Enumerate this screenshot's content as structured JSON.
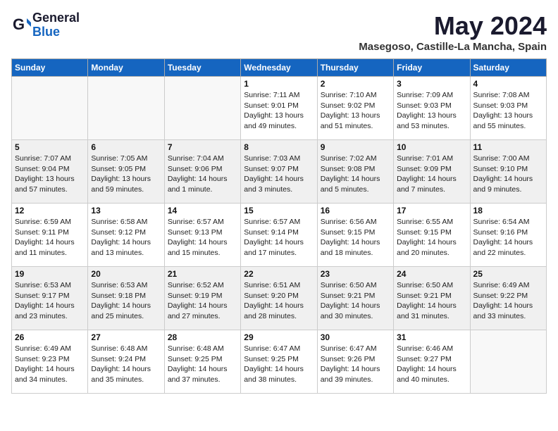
{
  "header": {
    "logo_general": "General",
    "logo_blue": "Blue",
    "title": "May 2024",
    "location": "Masegoso, Castille-La Mancha, Spain"
  },
  "weekdays": [
    "Sunday",
    "Monday",
    "Tuesday",
    "Wednesday",
    "Thursday",
    "Friday",
    "Saturday"
  ],
  "weeks": [
    [
      {
        "day": "",
        "info": []
      },
      {
        "day": "",
        "info": []
      },
      {
        "day": "",
        "info": []
      },
      {
        "day": "1",
        "info": [
          "Sunrise: 7:11 AM",
          "Sunset: 9:01 PM",
          "Daylight: 13 hours",
          "and 49 minutes."
        ]
      },
      {
        "day": "2",
        "info": [
          "Sunrise: 7:10 AM",
          "Sunset: 9:02 PM",
          "Daylight: 13 hours",
          "and 51 minutes."
        ]
      },
      {
        "day": "3",
        "info": [
          "Sunrise: 7:09 AM",
          "Sunset: 9:03 PM",
          "Daylight: 13 hours",
          "and 53 minutes."
        ]
      },
      {
        "day": "4",
        "info": [
          "Sunrise: 7:08 AM",
          "Sunset: 9:03 PM",
          "Daylight: 13 hours",
          "and 55 minutes."
        ]
      }
    ],
    [
      {
        "day": "5",
        "info": [
          "Sunrise: 7:07 AM",
          "Sunset: 9:04 PM",
          "Daylight: 13 hours",
          "and 57 minutes."
        ]
      },
      {
        "day": "6",
        "info": [
          "Sunrise: 7:05 AM",
          "Sunset: 9:05 PM",
          "Daylight: 13 hours",
          "and 59 minutes."
        ]
      },
      {
        "day": "7",
        "info": [
          "Sunrise: 7:04 AM",
          "Sunset: 9:06 PM",
          "Daylight: 14 hours",
          "and 1 minute."
        ]
      },
      {
        "day": "8",
        "info": [
          "Sunrise: 7:03 AM",
          "Sunset: 9:07 PM",
          "Daylight: 14 hours",
          "and 3 minutes."
        ]
      },
      {
        "day": "9",
        "info": [
          "Sunrise: 7:02 AM",
          "Sunset: 9:08 PM",
          "Daylight: 14 hours",
          "and 5 minutes."
        ]
      },
      {
        "day": "10",
        "info": [
          "Sunrise: 7:01 AM",
          "Sunset: 9:09 PM",
          "Daylight: 14 hours",
          "and 7 minutes."
        ]
      },
      {
        "day": "11",
        "info": [
          "Sunrise: 7:00 AM",
          "Sunset: 9:10 PM",
          "Daylight: 14 hours",
          "and 9 minutes."
        ]
      }
    ],
    [
      {
        "day": "12",
        "info": [
          "Sunrise: 6:59 AM",
          "Sunset: 9:11 PM",
          "Daylight: 14 hours",
          "and 11 minutes."
        ]
      },
      {
        "day": "13",
        "info": [
          "Sunrise: 6:58 AM",
          "Sunset: 9:12 PM",
          "Daylight: 14 hours",
          "and 13 minutes."
        ]
      },
      {
        "day": "14",
        "info": [
          "Sunrise: 6:57 AM",
          "Sunset: 9:13 PM",
          "Daylight: 14 hours",
          "and 15 minutes."
        ]
      },
      {
        "day": "15",
        "info": [
          "Sunrise: 6:57 AM",
          "Sunset: 9:14 PM",
          "Daylight: 14 hours",
          "and 17 minutes."
        ]
      },
      {
        "day": "16",
        "info": [
          "Sunrise: 6:56 AM",
          "Sunset: 9:15 PM",
          "Daylight: 14 hours",
          "and 18 minutes."
        ]
      },
      {
        "day": "17",
        "info": [
          "Sunrise: 6:55 AM",
          "Sunset: 9:15 PM",
          "Daylight: 14 hours",
          "and 20 minutes."
        ]
      },
      {
        "day": "18",
        "info": [
          "Sunrise: 6:54 AM",
          "Sunset: 9:16 PM",
          "Daylight: 14 hours",
          "and 22 minutes."
        ]
      }
    ],
    [
      {
        "day": "19",
        "info": [
          "Sunrise: 6:53 AM",
          "Sunset: 9:17 PM",
          "Daylight: 14 hours",
          "and 23 minutes."
        ]
      },
      {
        "day": "20",
        "info": [
          "Sunrise: 6:53 AM",
          "Sunset: 9:18 PM",
          "Daylight: 14 hours",
          "and 25 minutes."
        ]
      },
      {
        "day": "21",
        "info": [
          "Sunrise: 6:52 AM",
          "Sunset: 9:19 PM",
          "Daylight: 14 hours",
          "and 27 minutes."
        ]
      },
      {
        "day": "22",
        "info": [
          "Sunrise: 6:51 AM",
          "Sunset: 9:20 PM",
          "Daylight: 14 hours",
          "and 28 minutes."
        ]
      },
      {
        "day": "23",
        "info": [
          "Sunrise: 6:50 AM",
          "Sunset: 9:21 PM",
          "Daylight: 14 hours",
          "and 30 minutes."
        ]
      },
      {
        "day": "24",
        "info": [
          "Sunrise: 6:50 AM",
          "Sunset: 9:21 PM",
          "Daylight: 14 hours",
          "and 31 minutes."
        ]
      },
      {
        "day": "25",
        "info": [
          "Sunrise: 6:49 AM",
          "Sunset: 9:22 PM",
          "Daylight: 14 hours",
          "and 33 minutes."
        ]
      }
    ],
    [
      {
        "day": "26",
        "info": [
          "Sunrise: 6:49 AM",
          "Sunset: 9:23 PM",
          "Daylight: 14 hours",
          "and 34 minutes."
        ]
      },
      {
        "day": "27",
        "info": [
          "Sunrise: 6:48 AM",
          "Sunset: 9:24 PM",
          "Daylight: 14 hours",
          "and 35 minutes."
        ]
      },
      {
        "day": "28",
        "info": [
          "Sunrise: 6:48 AM",
          "Sunset: 9:25 PM",
          "Daylight: 14 hours",
          "and 37 minutes."
        ]
      },
      {
        "day": "29",
        "info": [
          "Sunrise: 6:47 AM",
          "Sunset: 9:25 PM",
          "Daylight: 14 hours",
          "and 38 minutes."
        ]
      },
      {
        "day": "30",
        "info": [
          "Sunrise: 6:47 AM",
          "Sunset: 9:26 PM",
          "Daylight: 14 hours",
          "and 39 minutes."
        ]
      },
      {
        "day": "31",
        "info": [
          "Sunrise: 6:46 AM",
          "Sunset: 9:27 PM",
          "Daylight: 14 hours",
          "and 40 minutes."
        ]
      },
      {
        "day": "",
        "info": []
      }
    ]
  ]
}
